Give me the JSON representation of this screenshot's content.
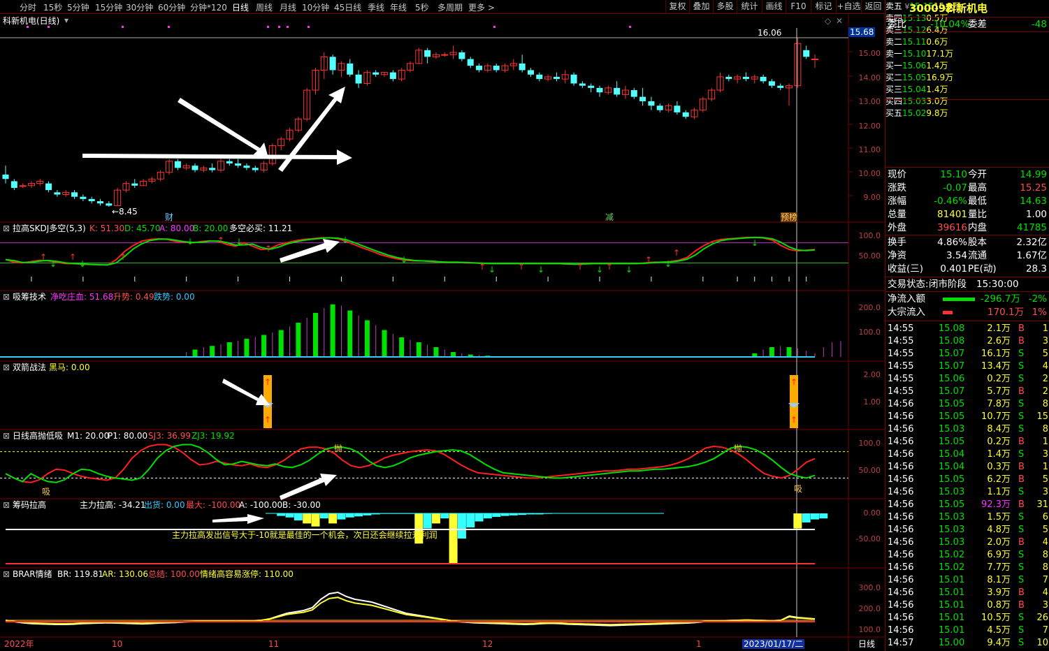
{
  "toolbar": {
    "periods": [
      "分时",
      "15秒",
      "5分钟",
      "15分钟",
      "30分钟",
      "60分钟",
      "分钟*120",
      "日线",
      "周线",
      "月线",
      "10分钟",
      "45日线",
      "季线",
      "年线",
      "5秒",
      "多周期",
      "更多 >"
    ],
    "active": "日线",
    "right": [
      "复权",
      "叠加",
      "多股",
      "统计",
      "画线",
      "F10",
      "标记",
      "+自选",
      "返回"
    ]
  },
  "main": {
    "title": "科新机电(日线)",
    "price_axis": [
      "16.06",
      "15.68",
      "15.00",
      "14.00",
      "13.00",
      "12.00",
      "11.00",
      "10.00",
      "9.00"
    ],
    "low_label": "←8.45",
    "markers": [
      "财",
      "减",
      "预榜"
    ]
  },
  "panels": {
    "skdj": {
      "title": "拉高SKDJ多空(5,3)",
      "k": "K: 51.30",
      "d": "D: 45.70",
      "a": "A: 80.00",
      "b": "B: 20.00",
      "dk": "多空必买: 11.21",
      "axis": [
        "100.0",
        "50.00"
      ]
    },
    "xichou": {
      "title": "吸筹技术",
      "jcz": "净吃庄血: 51.68",
      "ss": "升势: 0.49",
      "ds": "跌势: 0.00",
      "axis": [
        "200.0",
        "100.0"
      ]
    },
    "shuangjian": {
      "title": "双箭战法",
      "hm": "黑马: 0.00",
      "axis": [
        "2.00",
        "1.00"
      ]
    },
    "gaopao": {
      "title": "日线高抛低吸",
      "m1": "M1: 20.00",
      "p1": "P1: 80.00",
      "sj3": "SJ3: 36.99",
      "zj3": "ZJ3: 19.92",
      "axis": [
        "100.0",
        "50.00"
      ],
      "pao": "抛",
      "xi": "吸"
    },
    "choumal": {
      "title": "筹码拉高",
      "zlg": "主力拉高: -34.21",
      "ch": "出货: 0.00",
      "zd": "最大: -100.00",
      "a": "A: -100.00",
      "b": "B: -30.00",
      "axis": [
        "0.00",
        "-50.00"
      ],
      "note": "主力拉高发出信号大于-10就是最佳的一个机会，次日还会继续拉升利润"
    },
    "brar": {
      "title": "BRAR情绪",
      "br": "BR: 119.81",
      "ar": "AR: 130.06",
      "zj": "总结: 100.00",
      "qx": "情绪高容易涨停: 110.00",
      "axis": [
        "300.0",
        "200.0",
        "100.0"
      ]
    }
  },
  "xaxis": {
    "labels": [
      "2022年",
      "10",
      "11",
      "12",
      "1"
    ],
    "date": "2023/01/17/二",
    "period": "日线"
  },
  "chart_data": {
    "type": "candlestick",
    "title": "科新机电(日线)",
    "ylim": [
      8.45,
      16.06
    ],
    "ohlc": [
      [
        9.9,
        10.3,
        9.5,
        9.7
      ],
      [
        9.6,
        9.7,
        9.2,
        9.3
      ],
      [
        9.4,
        9.5,
        9.3,
        9.4
      ],
      [
        9.4,
        9.6,
        9.3,
        9.5
      ],
      [
        9.5,
        9.7,
        9.4,
        9.6
      ],
      [
        9.5,
        9.6,
        9.1,
        9.2
      ],
      [
        9.1,
        9.2,
        8.9,
        9.0
      ],
      [
        9.0,
        9.2,
        8.9,
        9.1
      ],
      [
        9.1,
        9.2,
        8.8,
        8.9
      ],
      [
        8.9,
        9.0,
        8.7,
        8.8
      ],
      [
        8.8,
        8.9,
        8.6,
        8.7
      ],
      [
        8.7,
        8.8,
        8.5,
        8.6
      ],
      [
        8.6,
        8.7,
        8.45,
        8.5
      ],
      [
        8.5,
        9.3,
        8.5,
        9.2
      ],
      [
        9.2,
        9.6,
        9.1,
        9.5
      ],
      [
        9.5,
        9.7,
        9.3,
        9.4
      ],
      [
        9.4,
        9.7,
        9.4,
        9.6
      ],
      [
        9.6,
        9.8,
        9.5,
        9.7
      ],
      [
        9.7,
        10.1,
        9.6,
        10.0
      ],
      [
        10.0,
        10.6,
        9.9,
        10.5
      ],
      [
        10.5,
        10.6,
        10.1,
        10.2
      ],
      [
        10.2,
        10.4,
        10.1,
        10.3
      ],
      [
        10.3,
        10.4,
        10.0,
        10.1
      ],
      [
        10.1,
        10.3,
        10.0,
        10.2
      ],
      [
        10.2,
        10.4,
        10.0,
        10.1
      ],
      [
        10.1,
        10.6,
        10.0,
        10.5
      ],
      [
        10.5,
        10.6,
        10.3,
        10.4
      ],
      [
        10.4,
        10.6,
        10.2,
        10.3
      ],
      [
        10.3,
        10.4,
        10.1,
        10.2
      ],
      [
        10.2,
        10.3,
        10.0,
        10.1
      ],
      [
        10.1,
        10.5,
        10.0,
        10.4
      ],
      [
        10.4,
        11.3,
        10.3,
        11.2
      ],
      [
        11.2,
        11.6,
        11.0,
        11.5
      ],
      [
        11.5,
        12.0,
        11.4,
        11.9
      ],
      [
        11.9,
        12.5,
        11.8,
        12.4
      ],
      [
        12.4,
        13.8,
        12.3,
        13.7
      ],
      [
        13.7,
        14.7,
        13.5,
        14.6
      ],
      [
        14.6,
        15.4,
        14.2,
        15.2
      ],
      [
        15.2,
        15.3,
        14.4,
        14.6
      ],
      [
        14.6,
        15.0,
        14.3,
        14.9
      ],
      [
        14.9,
        15.1,
        14.3,
        14.4
      ],
      [
        14.4,
        14.6,
        13.8,
        14.0
      ],
      [
        14.0,
        14.6,
        13.9,
        14.5
      ],
      [
        14.5,
        14.6,
        14.3,
        14.4
      ],
      [
        14.4,
        14.5,
        14.3,
        14.5
      ],
      [
        14.5,
        14.6,
        14.1,
        14.2
      ],
      [
        14.2,
        14.7,
        14.1,
        14.6
      ],
      [
        14.6,
        15.0,
        14.5,
        14.9
      ],
      [
        14.9,
        15.6,
        14.9,
        15.5
      ],
      [
        15.5,
        15.6,
        14.9,
        15.2
      ],
      [
        15.2,
        15.4,
        15.1,
        15.3
      ],
      [
        15.3,
        15.4,
        15.2,
        15.3
      ],
      [
        15.3,
        15.7,
        15.1,
        15.4
      ],
      [
        15.4,
        15.5,
        15.0,
        15.1
      ],
      [
        15.1,
        15.2,
        14.7,
        14.8
      ],
      [
        14.8,
        14.9,
        14.5,
        14.6
      ],
      [
        14.6,
        14.9,
        14.5,
        14.8
      ],
      [
        14.8,
        14.9,
        14.5,
        14.6
      ],
      [
        14.6,
        14.9,
        14.5,
        14.8
      ],
      [
        14.8,
        15.1,
        14.6,
        14.9
      ],
      [
        14.9,
        15.3,
        14.5,
        14.6
      ],
      [
        14.6,
        14.7,
        14.3,
        14.4
      ],
      [
        14.4,
        14.5,
        14.1,
        14.2
      ],
      [
        14.2,
        14.4,
        14.1,
        14.3
      ],
      [
        14.3,
        14.5,
        14.1,
        14.2
      ],
      [
        14.2,
        14.6,
        14.0,
        14.4
      ],
      [
        14.4,
        14.5,
        13.9,
        14.0
      ],
      [
        14.0,
        14.1,
        13.8,
        13.9
      ],
      [
        13.9,
        14.0,
        13.6,
        13.8
      ],
      [
        13.8,
        13.9,
        13.4,
        13.6
      ],
      [
        13.6,
        13.9,
        13.5,
        13.8
      ],
      [
        13.8,
        14.1,
        13.4,
        13.5
      ],
      [
        13.5,
        13.9,
        13.3,
        13.7
      ],
      [
        13.7,
        13.8,
        13.3,
        13.4
      ],
      [
        13.4,
        13.8,
        13.0,
        13.2
      ],
      [
        13.2,
        13.4,
        12.8,
        13.0
      ],
      [
        13.0,
        13.1,
        12.7,
        12.8
      ],
      [
        12.8,
        13.1,
        12.7,
        13.0
      ],
      [
        13.0,
        13.2,
        12.6,
        12.7
      ],
      [
        12.7,
        12.8,
        12.4,
        12.5
      ],
      [
        12.5,
        12.9,
        12.4,
        12.8
      ],
      [
        12.8,
        13.4,
        12.7,
        13.3
      ],
      [
        13.3,
        13.8,
        13.2,
        13.7
      ],
      [
        13.7,
        14.5,
        13.6,
        14.3
      ],
      [
        14.3,
        14.4,
        14.1,
        14.2
      ],
      [
        14.2,
        14.4,
        14.0,
        14.3
      ],
      [
        14.3,
        14.5,
        14.1,
        14.2
      ],
      [
        14.2,
        14.4,
        14.0,
        14.3
      ],
      [
        14.3,
        14.4,
        14.0,
        14.1
      ],
      [
        14.1,
        14.2,
        13.8,
        13.9
      ],
      [
        13.9,
        14.0,
        13.7,
        13.8
      ],
      [
        13.8,
        14.0,
        13.0,
        13.9
      ],
      [
        13.9,
        16.06,
        13.8,
        15.8
      ],
      [
        15.5,
        15.7,
        15.1,
        15.2
      ],
      [
        15.1,
        15.3,
        14.7,
        15.1
      ]
    ]
  },
  "side": {
    "code": "300092",
    "name": "科新机电",
    "wb": {
      "label": "委比",
      "value": "-10.04%",
      "wc_label": "委差",
      "wc": "-48"
    },
    "asks": [
      {
        "label": "卖五",
        "flag": "¥",
        "price": "15.15",
        "vol": "15.3万"
      },
      {
        "label": "卖四",
        "flag": "",
        "price": "15.13",
        "vol": "0.5万"
      },
      {
        "label": "卖三",
        "flag": "",
        "price": "15.12",
        "vol": "6.4万"
      },
      {
        "label": "卖二",
        "flag": "",
        "price": "15.11",
        "vol": "0.6万"
      },
      {
        "label": "卖一",
        "flag": "",
        "price": "15.10",
        "vol": "17.1万"
      }
    ],
    "bids": [
      {
        "label": "买一",
        "price": "15.06",
        "vol": "1.4万"
      },
      {
        "label": "买二",
        "price": "15.05",
        "vol": "16.9万"
      },
      {
        "label": "买三",
        "price": "15.04",
        "vol": "1.4万"
      },
      {
        "label": "买四",
        "price": "15.03",
        "vol": "3.0万"
      },
      {
        "label": "买五",
        "price": "15.02",
        "vol": "9.8万"
      }
    ],
    "stats": [
      {
        "l1": "现价",
        "v1": "15.10",
        "l2": "今开",
        "v2": "14.99",
        "c1": "green",
        "c2": "green"
      },
      {
        "l1": "涨跌",
        "v1": "-0.07",
        "l2": "最高",
        "v2": "15.25",
        "c1": "green",
        "c2": "red"
      },
      {
        "l1": "涨幅",
        "v1": "-0.46%",
        "l2": "最低",
        "v2": "14.63",
        "c1": "green",
        "c2": "green"
      },
      {
        "l1": "总量",
        "v1": "81401",
        "l2": "量比",
        "v2": "1.00",
        "c1": "yellow",
        "c2": "white"
      },
      {
        "l1": "外盘",
        "v1": "39616",
        "l2": "内盘",
        "v2": "41785",
        "c1": "red",
        "c2": "green"
      }
    ],
    "stats2": [
      {
        "l1": "换手",
        "v1": "4.86%",
        "l2": "股本",
        "v2": "2.32亿"
      },
      {
        "l1": "净资",
        "v1": "3.54",
        "l2": "流通",
        "v2": "1.67亿"
      },
      {
        "l1": "收益(三)",
        "v1": "0.401",
        "l2": "PE(动)",
        "v2": "28.3"
      }
    ],
    "status": {
      "label": "交易状态:",
      "value": "闭市阶段",
      "time": "15:30:00"
    },
    "flow": {
      "jl_label": "净流入额",
      "jl": "-296.7万",
      "jl_pct": "-2%",
      "dz_label": "大宗流入",
      "dz": "170.1万",
      "dz_pct": "1%"
    },
    "ticks": [
      [
        "14:55",
        "15.08",
        "2.1万",
        "B",
        "1"
      ],
      [
        "14:55",
        "15.08",
        "2.6万",
        "B",
        "3"
      ],
      [
        "14:55",
        "15.07",
        "16.1万",
        "S",
        "5"
      ],
      [
        "14:55",
        "15.07",
        "13.4万",
        "S",
        "4"
      ],
      [
        "14:55",
        "15.06",
        "0.2万",
        "S",
        "2"
      ],
      [
        "14:55",
        "15.07",
        "5.7万",
        "B",
        "2"
      ],
      [
        "14:56",
        "15.05",
        "7.8万",
        "S",
        "8"
      ],
      [
        "14:56",
        "15.05",
        "10.7万",
        "S",
        "15"
      ],
      [
        "14:56",
        "15.03",
        "8.4万",
        "S",
        "8"
      ],
      [
        "14:56",
        "15.05",
        "0.2万",
        "B",
        "1"
      ],
      [
        "14:56",
        "15.04",
        "1.4万",
        "S",
        "3"
      ],
      [
        "14:56",
        "15.04",
        "0.3万",
        "B",
        "1"
      ],
      [
        "14:56",
        "15.05",
        "6.2万",
        "B",
        "5"
      ],
      [
        "14:56",
        "15.03",
        "1.1万",
        "S",
        "3"
      ],
      [
        "14:56",
        "15.05",
        "92.3万",
        "B",
        "31"
      ],
      [
        "14:56",
        "15.03",
        "1.5万",
        "S",
        "6"
      ],
      [
        "14:56",
        "15.03",
        "4.8万",
        "S",
        "5"
      ],
      [
        "14:56",
        "15.03",
        "2.0万",
        "B",
        "4"
      ],
      [
        "14:56",
        "15.02",
        "6.9万",
        "S",
        "8"
      ],
      [
        "14:56",
        "15.02",
        "7.7万",
        "S",
        "8"
      ],
      [
        "14:56",
        "15.01",
        "8.1万",
        "S",
        "7"
      ],
      [
        "14:56",
        "15.01",
        "3.9万",
        "B",
        "4"
      ],
      [
        "14:56",
        "15.01",
        "0.8万",
        "B",
        "3"
      ],
      [
        "14:56",
        "15.01",
        "10.5万",
        "S",
        "26"
      ],
      [
        "14:56",
        "15.01",
        "4.5万",
        "S",
        "7"
      ],
      [
        "14:57",
        "15.00",
        "9.4万",
        "S",
        "10"
      ]
    ]
  },
  "colors": {
    "up": "#ff3232",
    "down": "#54ffff",
    "border": "#7a0000",
    "yellow": "#ffff33",
    "green": "#00e000"
  }
}
